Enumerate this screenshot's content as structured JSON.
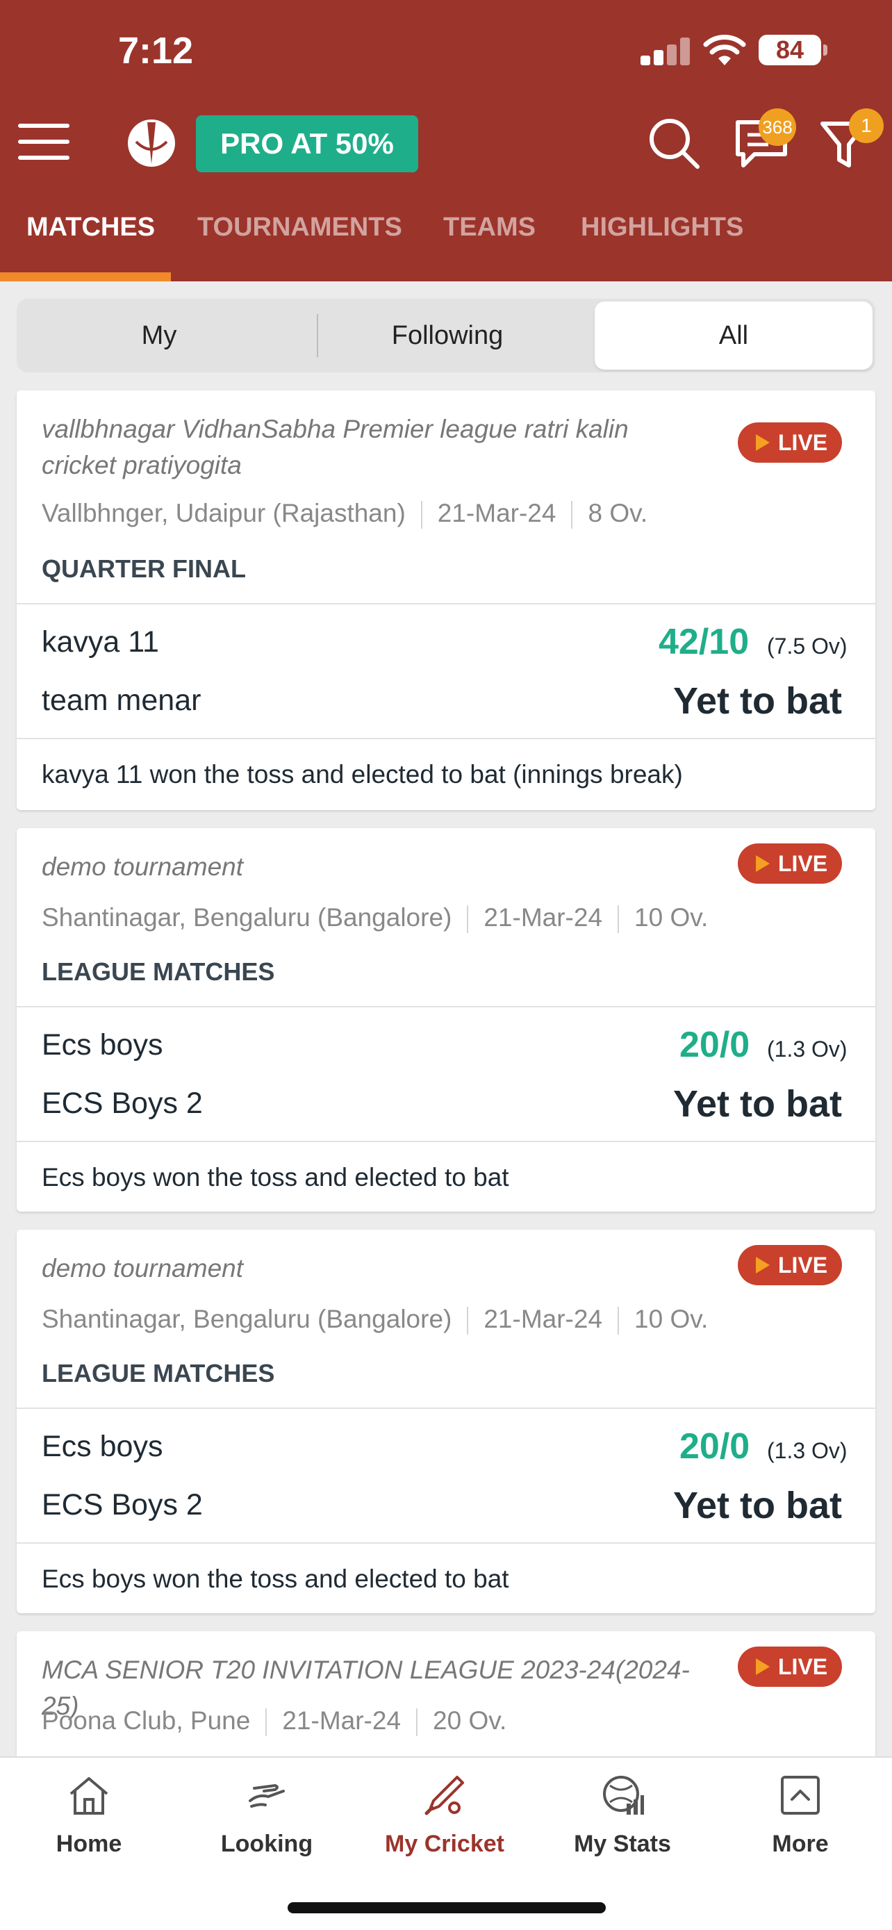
{
  "status_bar": {
    "time": "7:12",
    "battery": "84"
  },
  "header": {
    "pro_button": "PRO AT 50%",
    "chat_badge": "368",
    "filter_badge": "1",
    "tabs": [
      {
        "label": "MATCHES"
      },
      {
        "label": "TOURNAMENTS"
      },
      {
        "label": "TEAMS"
      },
      {
        "label": "HIGHLIGHTS"
      }
    ]
  },
  "segmented": {
    "options": [
      "My",
      "Following",
      "All"
    ],
    "selected": "All"
  },
  "matches": [
    {
      "tournament": "vallbhnagar  VidhanSabha  Premier league ratri kalin cricket pratiyogita",
      "live": "LIVE",
      "location": "Vallbhnger, Udaipur (Rajasthan)",
      "date": "21-Mar-24",
      "overs": "8 Ov.",
      "round": "QUARTER FINAL",
      "team1": "kavya 11",
      "team1_score": "42/10",
      "team1_overs": "(7.5 Ov)",
      "team2": "team menar",
      "team2_status": "Yet to bat",
      "status": "kavya 11 won the toss and elected to bat (innings break)"
    },
    {
      "tournament": "demo tournament",
      "live": "LIVE",
      "location": "Shantinagar, Bengaluru (Bangalore)",
      "date": "21-Mar-24",
      "overs": "10 Ov.",
      "round": "LEAGUE MATCHES",
      "team1": "Ecs boys",
      "team1_score": "20/0",
      "team1_overs": "(1.3 Ov)",
      "team2": "ECS Boys 2",
      "team2_status": "Yet to bat",
      "status": "Ecs boys won the toss and elected to bat"
    },
    {
      "tournament": "demo tournament",
      "live": "LIVE",
      "location": "Shantinagar, Bengaluru (Bangalore)",
      "date": "21-Mar-24",
      "overs": "10 Ov.",
      "round": "LEAGUE MATCHES",
      "team1": "Ecs boys",
      "team1_score": "20/0",
      "team1_overs": "(1.3 Ov)",
      "team2": "ECS Boys 2",
      "team2_status": "Yet to bat",
      "status": "Ecs boys won the toss and elected to bat"
    },
    {
      "tournament": "MCA SENIOR T20 INVITATION LEAGUE 2023-24(2024-25)",
      "live": "LIVE",
      "location": "Poona Club, Pune",
      "date": "21-Mar-24",
      "overs": "20 Ov."
    }
  ],
  "bottom_nav": [
    {
      "label": "Home",
      "icon": "home-icon"
    },
    {
      "label": "Looking",
      "icon": "looking-icon"
    },
    {
      "label": "My Cricket",
      "icon": "cricket-bat-icon"
    },
    {
      "label": "My Stats",
      "icon": "stats-icon"
    },
    {
      "label": "More",
      "icon": "more-icon"
    }
  ],
  "colors": {
    "header": "#9b342b",
    "accent": "#1fae8a",
    "live": "#c9402d",
    "tab_indicator": "#f08a2a"
  }
}
